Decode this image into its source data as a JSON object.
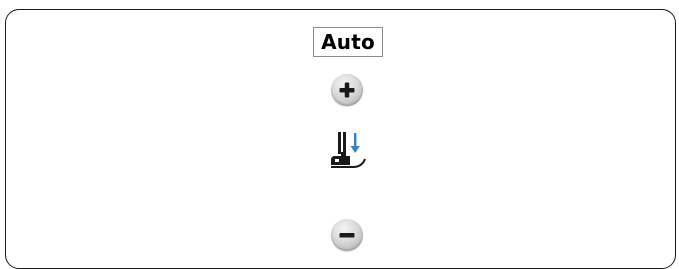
{
  "control": {
    "mode_label": "Auto"
  },
  "icons": {
    "increase": "plus-icon",
    "presser_foot": "presser-foot-height-icon",
    "decrease": "minus-icon"
  },
  "colors": {
    "icon_dark": "#1a1a1a",
    "arrow_blue": "#2a86c8",
    "button_light": "#d9d9d9"
  }
}
